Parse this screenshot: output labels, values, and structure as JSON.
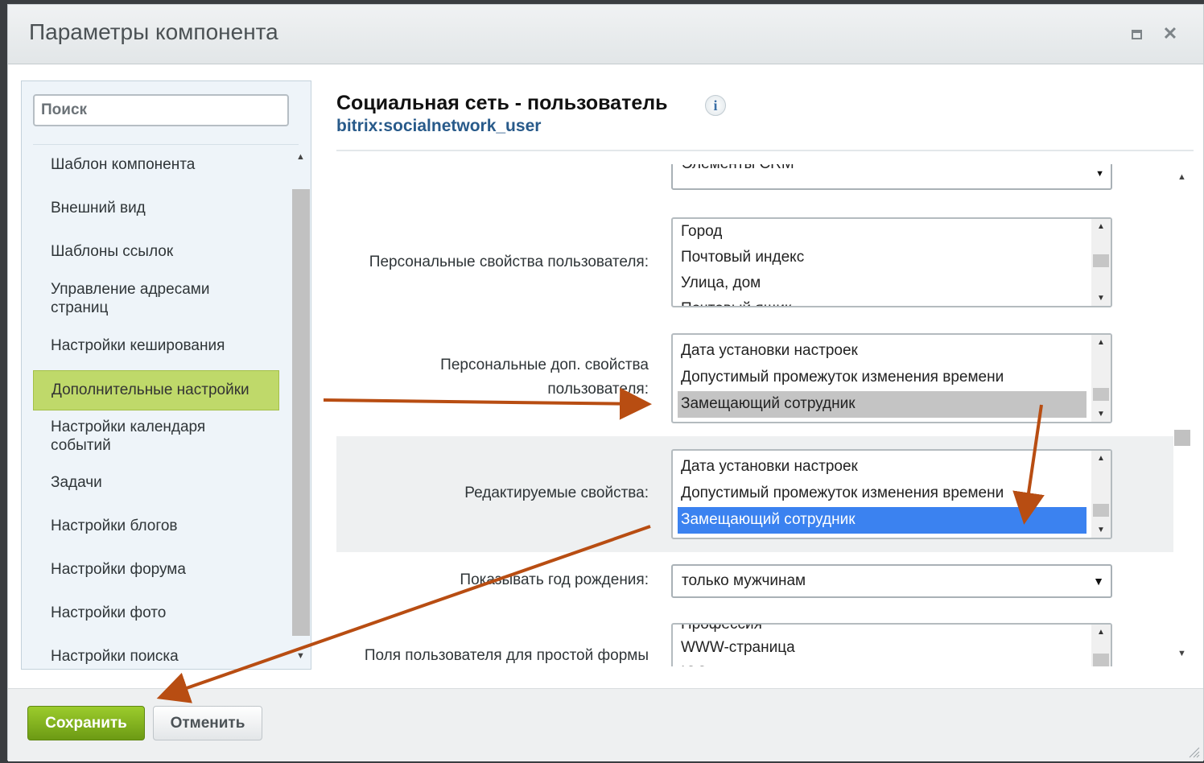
{
  "dialog": {
    "title": "Параметры компонента",
    "maximize_icon": "maximize-icon",
    "close_icon": "close-icon"
  },
  "search": {
    "placeholder": "Поиск"
  },
  "nav": {
    "items": [
      {
        "label": "Шаблон компонента"
      },
      {
        "label": "Внешний вид"
      },
      {
        "label": "Шаблоны ссылок"
      },
      {
        "label": "Управление адресами страниц"
      },
      {
        "label": "Настройки кеширования"
      },
      {
        "label": "Дополнительные настройки",
        "active": true
      },
      {
        "label": "Настройки календаря событий"
      },
      {
        "label": "Задачи"
      },
      {
        "label": "Настройки блогов"
      },
      {
        "label": "Настройки форума"
      },
      {
        "label": "Настройки фото"
      },
      {
        "label": "Настройки поиска"
      }
    ]
  },
  "header": {
    "title": "Социальная сеть - пользователь",
    "code": "bitrix:socialnetwork_user",
    "info_icon": "i"
  },
  "props": {
    "top_select_text": "Элементы CRM",
    "personal": {
      "label": "Персональные свойства пользователя:",
      "options": [
        "Город",
        "Почтовый индекс",
        "Улица, дом",
        "Почтовый ящик"
      ]
    },
    "personal_extra": {
      "label": "Персональные доп. свойства пользователя:",
      "options": [
        "Дата установки настроек",
        "Допустимый промежуток изменения времени",
        "Замещающий сотрудник"
      ],
      "selected": "Замещающий сотрудник"
    },
    "editable": {
      "label": "Редактируемые свойства:",
      "options": [
        "Дата установки настроек",
        "Допустимый промежуток изменения времени",
        "Замещающий сотрудник"
      ],
      "selected": "Замещающий сотрудник"
    },
    "birth_year": {
      "label": "Показывать год рождения:",
      "value": "только мужчинам"
    },
    "simple_form": {
      "label": "Поля пользователя для простой формы",
      "options": [
        "Профессия",
        "WWW-страница",
        "ICQ"
      ]
    }
  },
  "footer": {
    "save": "Сохранить",
    "cancel": "Отменить"
  },
  "colors": {
    "accent_green": "#8cbd24",
    "nav_active": "#bfd96a",
    "selection_blue": "#3b82f0",
    "annotation_arrow": "#b84d12"
  }
}
